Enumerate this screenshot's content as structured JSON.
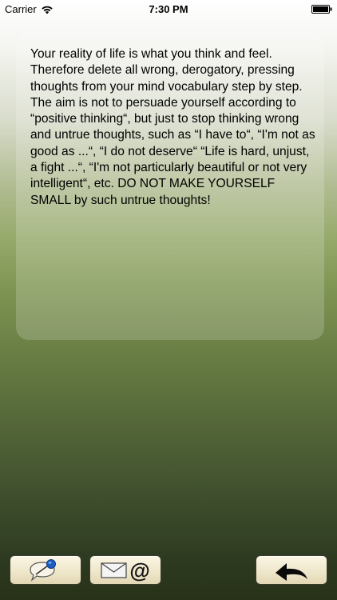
{
  "status_bar": {
    "carrier": "Carrier",
    "time": "7:30 PM"
  },
  "content": {
    "text": "Your reality of life is what you think and feel. Therefore delete all wrong, derogatory, pressing thoughts from your mind vocabulary step by step. The aim is not to persuade yourself according to “positive thinking“, but just to stop thinking wrong and untrue thoughts, such as “I have to“, “I'm not as good as ...“, “I do not deserve“ “Life is hard, unjust, a fight ...“, “I'm not particularly beautiful or not very intelligent“, etc. DO NOT MAKE YOURSELF SMALL by such untrue thoughts!"
  },
  "toolbar": {
    "mail_at_symbol": "@"
  },
  "icons": {
    "notes": "pin-speech-bubble-icon",
    "mail": "envelope-icon",
    "back": "back-arrow-icon",
    "wifi": "wifi-icon",
    "battery": "battery-icon"
  }
}
